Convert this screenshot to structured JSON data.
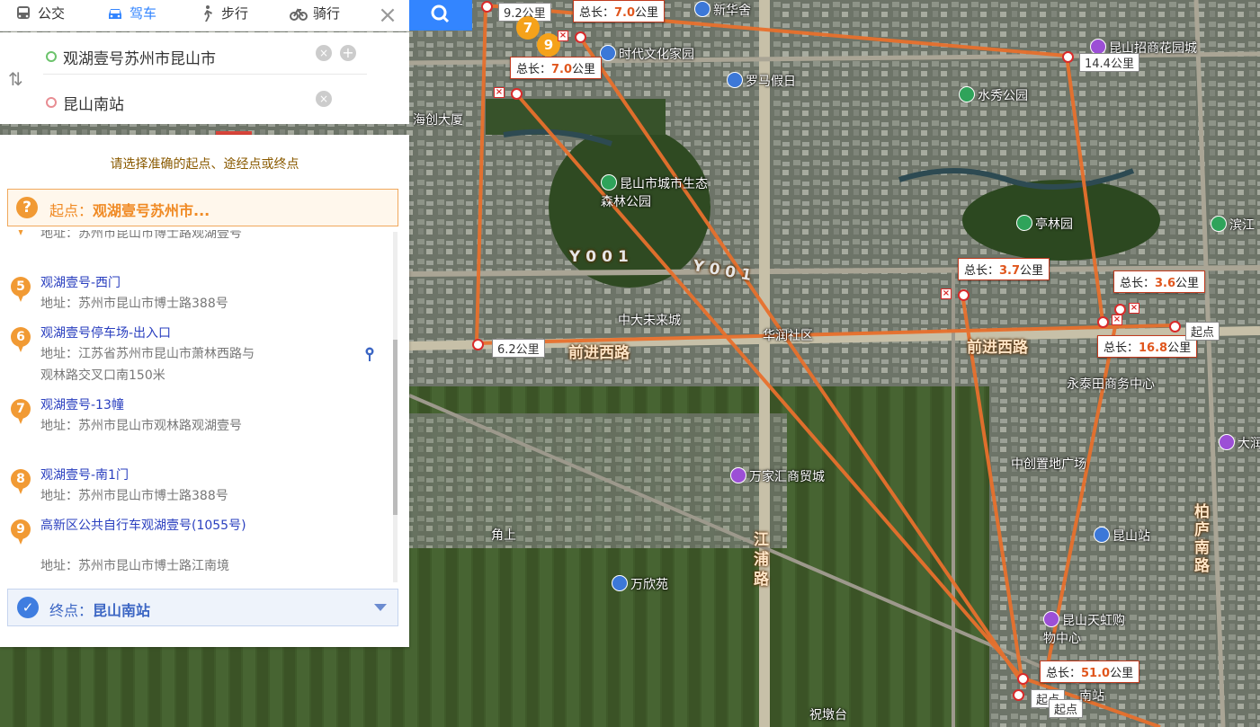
{
  "tabs": [
    {
      "label": "公交",
      "icon": "bus-icon"
    },
    {
      "label": "驾车",
      "icon": "car-icon"
    },
    {
      "label": "步行",
      "icon": "walk-icon"
    },
    {
      "label": "骑行",
      "icon": "bike-icon"
    }
  ],
  "active_tab": "驾车",
  "route_inputs": {
    "origin": "观湖壹号苏州市昆山市",
    "destination": "昆山南站"
  },
  "panel": {
    "hint": "请选择准确的起点、途经点或终点",
    "start_label": "起点：",
    "start_value": "观湖壹号苏州市...",
    "end_label": "终点：",
    "end_value": "昆山南站",
    "partial_addr": "地址：苏州市昆山市博士路观湖壹号",
    "candidates": [
      {
        "index": "5",
        "name": "观湖壹号-西门",
        "address": "地址：苏州市昆山市博士路388号"
      },
      {
        "index": "6",
        "name": "观湖壹号停车场-出入口",
        "address": "地址：江苏省苏州市昆山市萧林西路与观林路交叉口南150米"
      },
      {
        "index": "7",
        "name": "观湖壹号-13幢",
        "address": "地址：苏州市昆山市观林路观湖壹号"
      },
      {
        "index": "8",
        "name": "观湖壹号-南1门",
        "address": "地址：苏州市昆山市博士路388号"
      },
      {
        "index": "9",
        "name": "高新区公共自行车观湖壹号(1055号)",
        "address": "地址：苏州市昆山市博士路江南境"
      }
    ]
  },
  "map": {
    "places": [
      {
        "name": "新华舍"
      },
      {
        "name": "时代文化家园"
      },
      {
        "name": "罗马假日"
      },
      {
        "name": "昆山招商花园城"
      },
      {
        "name": "水秀公园"
      },
      {
        "name": "海创大厦"
      },
      {
        "name": "昆山市城市生态森林公园"
      },
      {
        "name": "亭林园"
      },
      {
        "name": "滨江"
      },
      {
        "name": "中大未来城"
      },
      {
        "name": "华润社区"
      },
      {
        "name": "永泰田商务中心"
      },
      {
        "name": "中创置地广场"
      },
      {
        "name": "万家汇商贸城"
      },
      {
        "name": "昆山站"
      },
      {
        "name": "角上"
      },
      {
        "name": "万欣苑"
      },
      {
        "name": "昆山天虹购物中心"
      },
      {
        "name": "祝墩台"
      },
      {
        "name": "大润"
      }
    ],
    "roads": [
      "前进西路",
      "前进西路",
      "江浦路",
      "柏庐南路",
      "Y001",
      "Y001"
    ],
    "route_totals": [
      {
        "prefix": "总长：",
        "value": "7.0",
        "unit": "公里"
      },
      {
        "prefix": "总长：",
        "value": "7.0",
        "unit": "公里"
      },
      {
        "prefix": "总长：",
        "value": "3.7",
        "unit": "公里"
      },
      {
        "prefix": "总长：",
        "value": "3.6",
        "unit": "公里"
      },
      {
        "prefix": "总长：",
        "value": "16.8",
        "unit": "公里"
      },
      {
        "prefix": "总长：",
        "value": "51.0",
        "unit": "公里"
      }
    ],
    "segment_lengths": [
      "9.2公里",
      "14.4公里",
      "6.2公里"
    ],
    "start_tags": [
      "起点",
      "起点",
      "起点"
    ],
    "station_label": "南站",
    "clusters": [
      "7",
      "9"
    ],
    "route_color": "#e8702d"
  }
}
